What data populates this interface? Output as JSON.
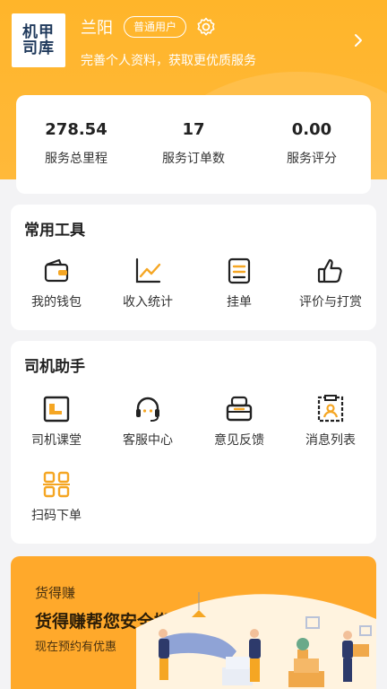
{
  "header": {
    "logo_text": "机甲司库",
    "user_name": "兰阳",
    "user_badge": "普通用户",
    "settings_icon": "gear-icon",
    "profile_hint": "完善个人资料，获取更优质服务",
    "chevron_icon": "chevron-right-icon"
  },
  "stats": [
    {
      "value": "278.54",
      "label": "服务总里程"
    },
    {
      "value": "17",
      "label": "服务订单数"
    },
    {
      "value": "0.00",
      "label": "服务评分"
    }
  ],
  "tools": {
    "title": "常用工具",
    "items": [
      {
        "label": "我的钱包",
        "icon": "wallet-icon"
      },
      {
        "label": "收入统计",
        "icon": "line-chart-icon"
      },
      {
        "label": "挂单",
        "icon": "order-sheet-icon"
      },
      {
        "label": "评价与打赏",
        "icon": "thumbs-up-icon"
      }
    ]
  },
  "assistant": {
    "title": "司机助手",
    "items": [
      {
        "label": "司机课堂",
        "icon": "classroom-icon"
      },
      {
        "label": "客服中心",
        "icon": "headset-icon"
      },
      {
        "label": "意见反馈",
        "icon": "feedback-icon"
      },
      {
        "label": "消息列表",
        "icon": "message-list-icon"
      },
      {
        "label": "扫码下单",
        "icon": "qr-scan-icon"
      }
    ]
  },
  "promo": {
    "small": "货得赚",
    "headline": "货得赚帮您安全搬家",
    "note": "现在预约有优惠"
  },
  "colors": {
    "accent": "#ffb52a",
    "icon_dark": "#222222",
    "icon_accent": "#f5a623",
    "background": "#f3f3f5"
  }
}
